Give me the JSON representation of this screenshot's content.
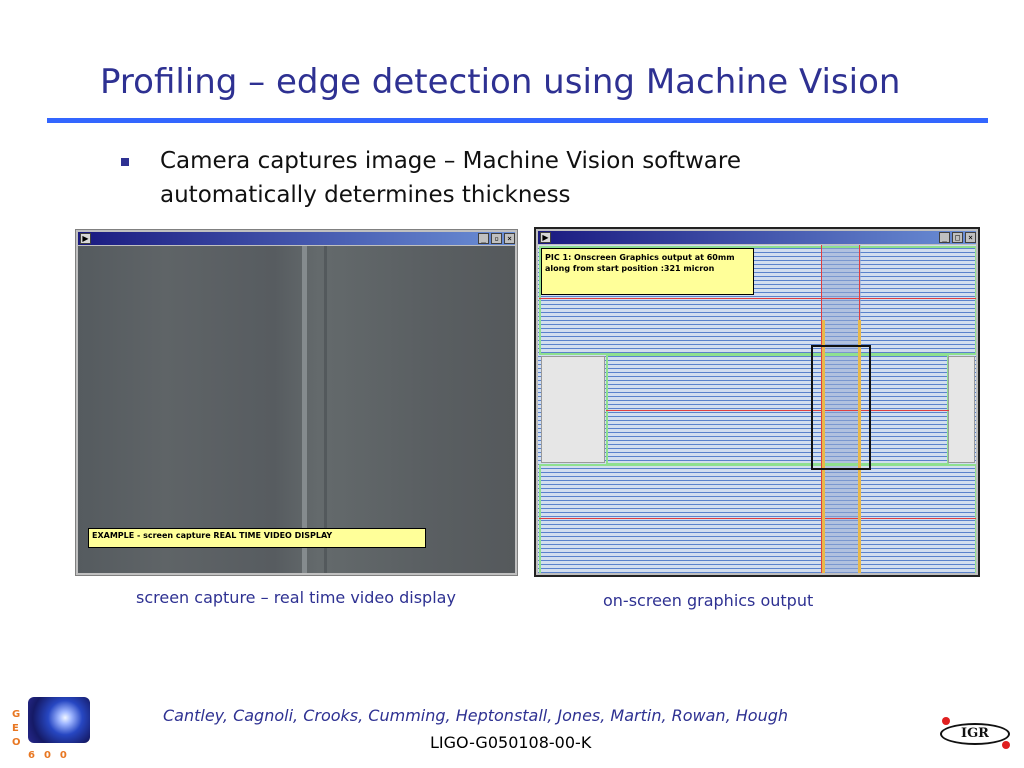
{
  "slide": {
    "title": "Profiling – edge detection using Machine Vision",
    "bullet": "Camera captures image – Machine Vision software automatically determines thickness"
  },
  "window_left": {
    "sys_icon": "▶",
    "buttons": [
      "_",
      "▫",
      "×"
    ],
    "overlay_text": "EXAMPLE  - screen capture REAL TIME VIDEO DISPLAY",
    "caption": "screen capture – real time video display"
  },
  "window_right": {
    "sys_icon": "▶",
    "buttons": [
      "_",
      "□",
      "×"
    ],
    "overlay_text": "PIC 1: Onscreen Graphics output at 60mm along from start position :321 micron",
    "caption": "on-screen graphics output"
  },
  "footer": {
    "authors": "Cantley, Cagnoli, Crooks, Cumming, Heptonstall, Jones, Martin, Rowan, Hough",
    "doc_id": "LIGO-G050108-00-K",
    "geo_letters": [
      "G",
      "E",
      "O"
    ],
    "geo_number": "600",
    "igr_text": "IGR"
  },
  "colors": {
    "title": "#2e3192",
    "rule": "#3366ff",
    "overlay_note": "#ffff99"
  }
}
